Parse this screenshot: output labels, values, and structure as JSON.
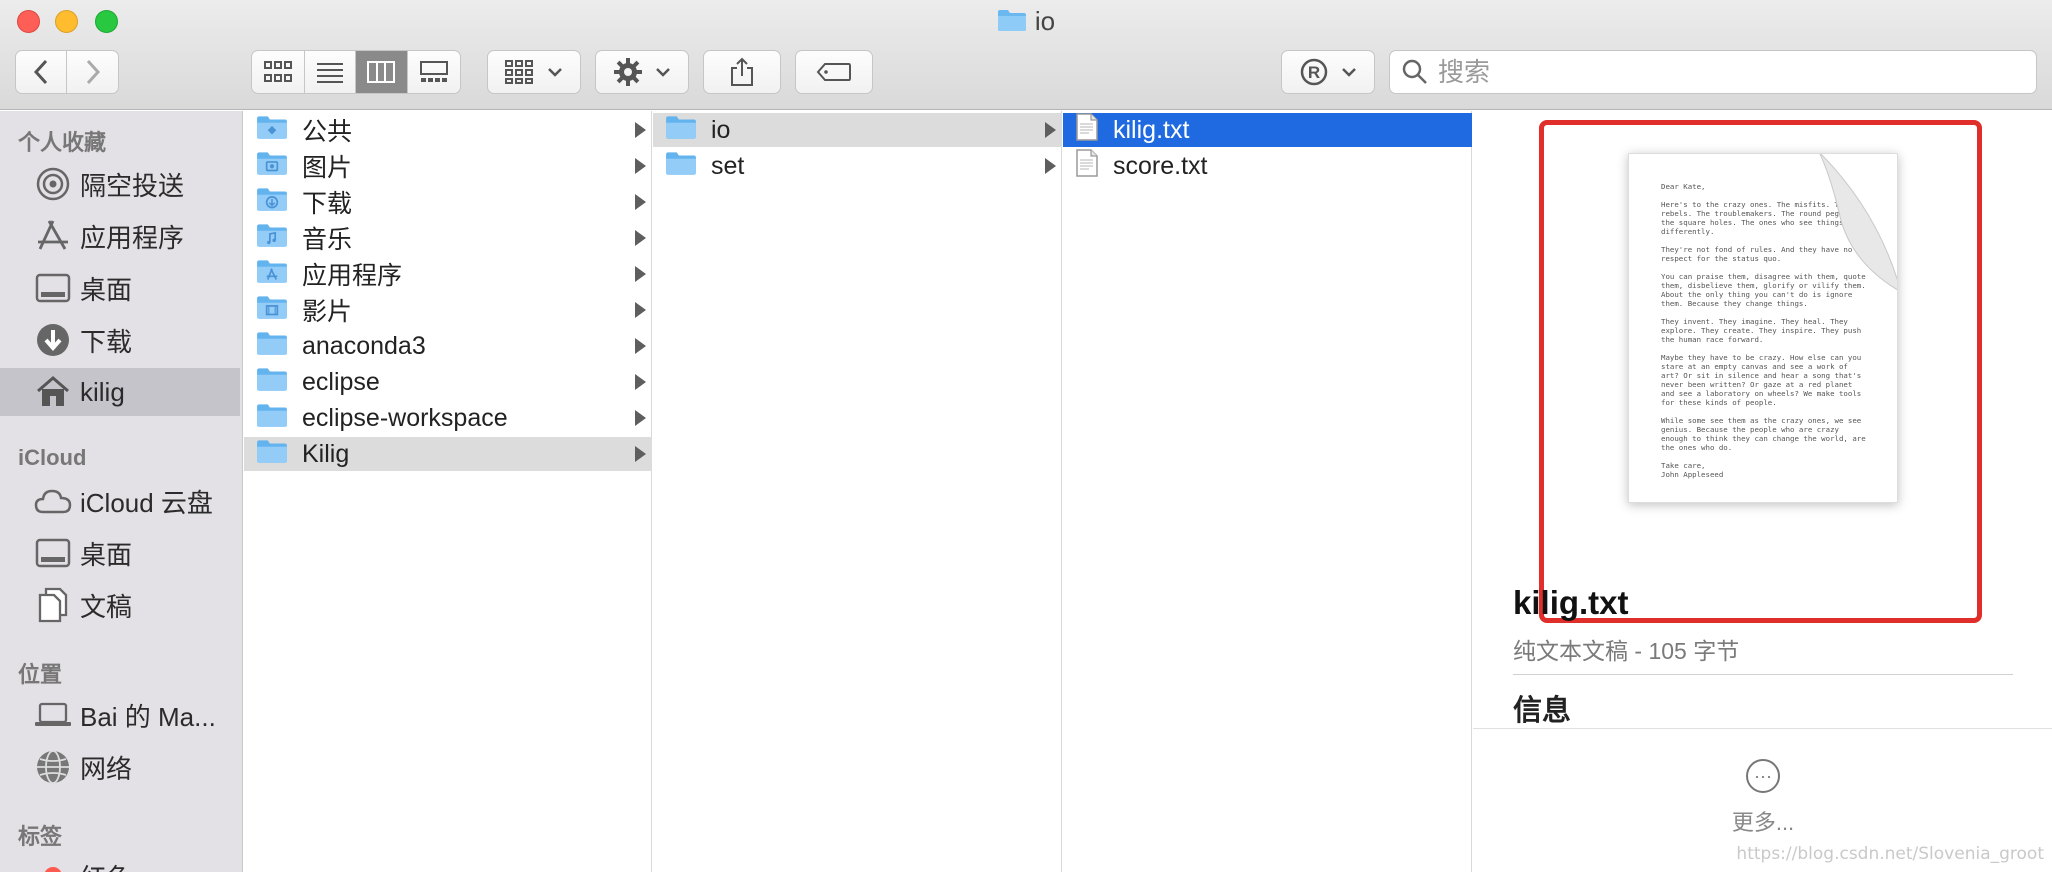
{
  "window": {
    "title": "io"
  },
  "toolbar": {
    "view_modes": [
      "icon-view",
      "list-view",
      "column-view",
      "gallery-view"
    ],
    "active_view": "column-view",
    "search_placeholder": "搜索"
  },
  "sidebar": {
    "favorites_header": "个人收藏",
    "favorites": [
      {
        "label": "隔空投送",
        "icon": "airdrop-icon"
      },
      {
        "label": "应用程序",
        "icon": "applications-icon"
      },
      {
        "label": "桌面",
        "icon": "desktop-icon"
      },
      {
        "label": "下载",
        "icon": "downloads-icon"
      },
      {
        "label": "kilig",
        "icon": "home-icon",
        "selected": true
      }
    ],
    "icloud_header": "iCloud",
    "icloud": [
      {
        "label": "iCloud 云盘",
        "icon": "cloud-icon"
      },
      {
        "label": "桌面",
        "icon": "desktop-icon"
      },
      {
        "label": "文稿",
        "icon": "documents-icon"
      }
    ],
    "locations_header": "位置",
    "locations": [
      {
        "label": "Bai 的 Ma...",
        "icon": "laptop-icon"
      },
      {
        "label": "网络",
        "icon": "network-icon"
      }
    ],
    "tags_header": "标签",
    "tags": [
      {
        "label": "红色",
        "color": "#ff5a52"
      }
    ]
  },
  "columns": {
    "col1": [
      {
        "label": "公共",
        "icon": "public-folder-icon",
        "has_children": true
      },
      {
        "label": "图片",
        "icon": "pictures-folder-icon",
        "has_children": true
      },
      {
        "label": "下载",
        "icon": "downloads-folder-icon",
        "has_children": true
      },
      {
        "label": "音乐",
        "icon": "music-folder-icon",
        "has_children": true
      },
      {
        "label": "应用程序",
        "icon": "applications-folder-icon",
        "has_children": true
      },
      {
        "label": "影片",
        "icon": "movies-folder-icon",
        "has_children": true
      },
      {
        "label": "anaconda3",
        "icon": "folder-icon",
        "has_children": true
      },
      {
        "label": "eclipse",
        "icon": "folder-icon",
        "has_children": true
      },
      {
        "label": "eclipse-workspace",
        "icon": "folder-icon",
        "has_children": true
      },
      {
        "label": "Kilig",
        "icon": "folder-icon",
        "has_children": true,
        "selected": true
      }
    ],
    "col2": [
      {
        "label": "io",
        "icon": "folder-icon",
        "has_children": true,
        "selected": true
      },
      {
        "label": "set",
        "icon": "folder-icon",
        "has_children": true
      }
    ],
    "col3": [
      {
        "label": "kilig.txt",
        "icon": "text-file-icon",
        "selected": true
      },
      {
        "label": "score.txt",
        "icon": "text-file-icon"
      }
    ]
  },
  "preview": {
    "document_text": "Dear Kate,\n\nHere's to the crazy ones. The misfits. The rebels. The troublemakers. The round pegs in the square holes. The ones who see things differently.\n\nThey're not fond of rules. And they have no respect for the status quo.\n\nYou can praise them, disagree with them, quote them, disbelieve them, glorify or vilify them. About the only thing you can't do is ignore them. Because they change things.\n\nThey invent. They imagine. They heal. They explore. They create. They inspire. They push the human race forward.\n\nMaybe they have to be crazy. How else can you stare at an empty canvas and see a work of art? Or sit in silence and hear a song that's never been written? Or gaze at a red planet and see a laboratory on wheels? We make tools for these kinds of people.\n\nWhile some see them as the crazy ones, we see genius. Because the people who are crazy enough to think they can change the world, are the ones who do.\n\nTake care,\nJohn Appleseed",
    "file_name": "kilig.txt",
    "file_kind": "纯文本文稿 - 105 字节",
    "info_header": "信息",
    "more_label": "更多..."
  },
  "watermark": "https://blog.csdn.net/Slovenia_groot",
  "colors": {
    "selection_blue": "#1f6ae0",
    "highlight_red": "#e02f2a",
    "folder_blue": "#63b3ee"
  }
}
